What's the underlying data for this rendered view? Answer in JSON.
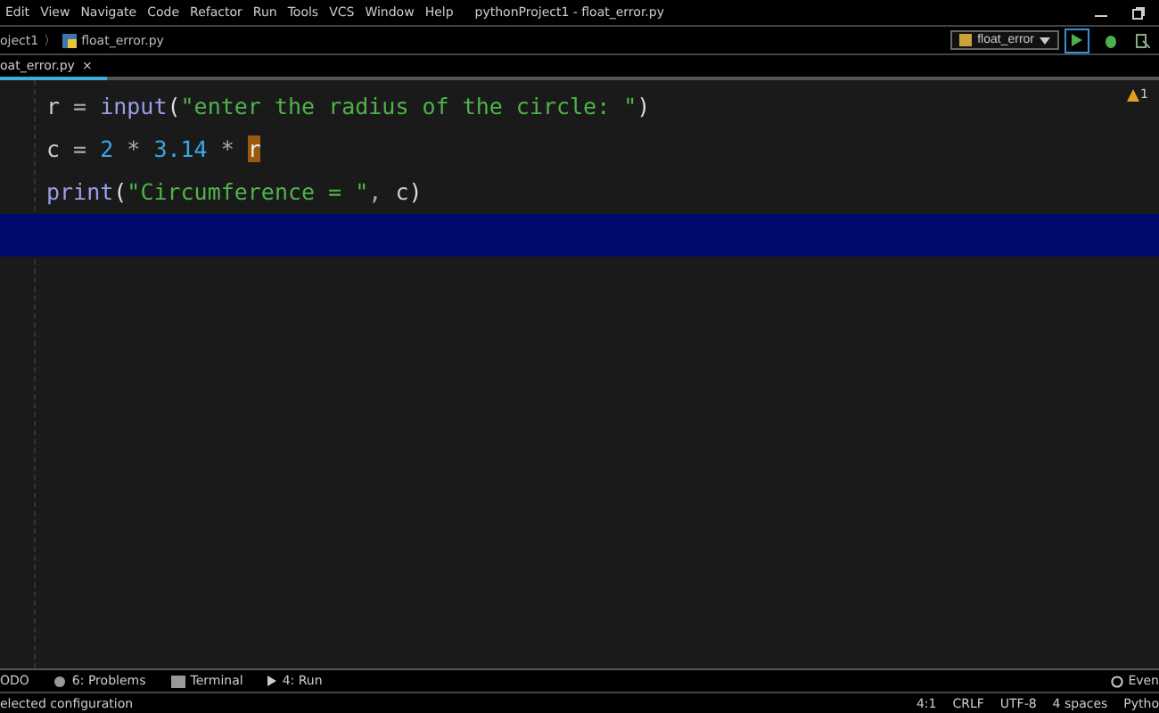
{
  "menu": [
    "Edit",
    "View",
    "Navigate",
    "Code",
    "Refactor",
    "Run",
    "Tools",
    "VCS",
    "Window",
    "Help"
  ],
  "window": {
    "title": "pythonProject1 - float_error.py"
  },
  "breadcrumb": {
    "project": "oject1",
    "separator": "〉",
    "file": "float_error.py"
  },
  "run_config": {
    "label": "float_error"
  },
  "tabs": [
    {
      "label": "oat_error.py",
      "close": "×",
      "selected": true
    }
  ],
  "editor": {
    "warning_count": "1",
    "lines": [
      {
        "current": false,
        "tokens": [
          {
            "kind": "ident",
            "text": "r"
          },
          {
            "kind": "op",
            "text": " = "
          },
          {
            "kind": "func",
            "text": "input"
          },
          {
            "kind": "paren",
            "text": "("
          },
          {
            "kind": "string",
            "text": "\"enter the radius of the circle: \""
          },
          {
            "kind": "paren",
            "text": ")"
          }
        ]
      },
      {
        "current": false,
        "tokens": [
          {
            "kind": "ident",
            "text": "c"
          },
          {
            "kind": "op",
            "text": " = "
          },
          {
            "kind": "number",
            "text": "2"
          },
          {
            "kind": "op",
            "text": " * "
          },
          {
            "kind": "number",
            "text": "3.14"
          },
          {
            "kind": "op",
            "text": " * "
          },
          {
            "kind": "caret",
            "text": "r"
          }
        ]
      },
      {
        "current": false,
        "tokens": [
          {
            "kind": "func",
            "text": "print"
          },
          {
            "kind": "paren",
            "text": "("
          },
          {
            "kind": "string",
            "text": "\"Circumference = \""
          },
          {
            "kind": "op",
            "text": ", "
          },
          {
            "kind": "ident",
            "text": "c"
          },
          {
            "kind": "paren",
            "text": ")"
          }
        ]
      },
      {
        "current": true
      }
    ]
  },
  "tool_windows": [
    {
      "label": "ODO",
      "kind": "todo"
    },
    {
      "label": "6: Problems",
      "kind": "problems"
    },
    {
      "label": "Terminal",
      "kind": "terminal"
    },
    {
      "label": "4: Run",
      "kind": "run"
    }
  ],
  "event_log": {
    "label": "Even"
  },
  "status_bar": {
    "message": "elected configuration",
    "items": [
      "4:1",
      "CRLF",
      "UTF-8",
      "4 spaces",
      "Pytho"
    ]
  }
}
